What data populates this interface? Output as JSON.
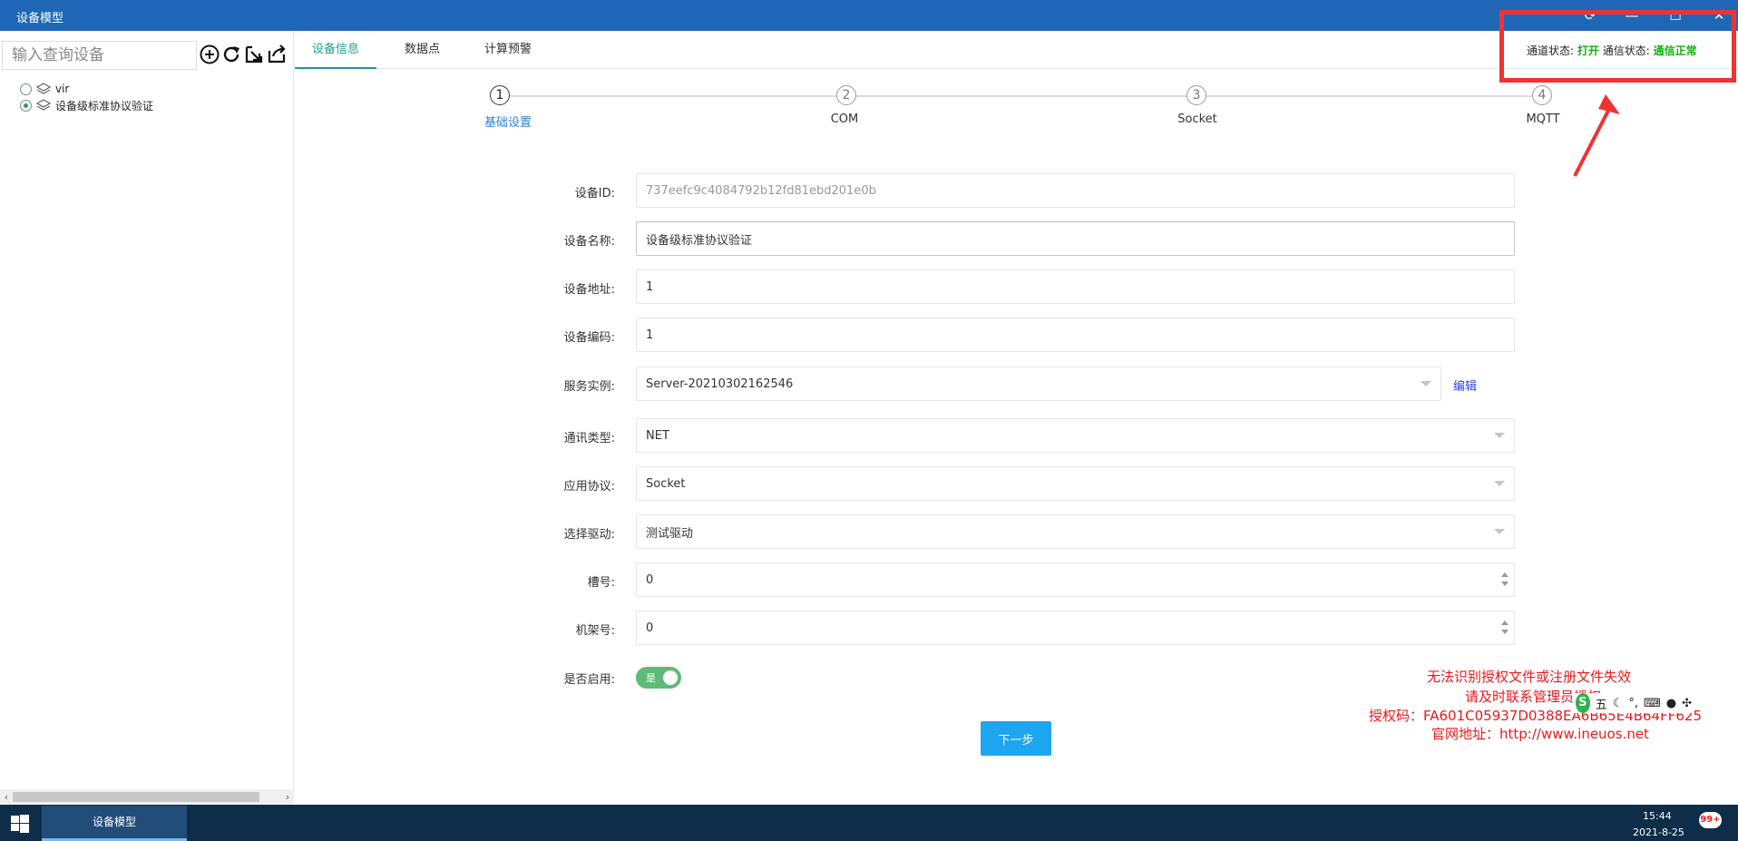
{
  "window": {
    "title": "设备模型"
  },
  "sidebar": {
    "search_placeholder": "输入查询设备",
    "tree": [
      {
        "label": "vir",
        "selected": false
      },
      {
        "label": "设备级标准协议验证",
        "selected": true
      }
    ]
  },
  "tabs": [
    {
      "label": "设备信息",
      "active": true
    },
    {
      "label": "数据点",
      "active": false
    },
    {
      "label": "计算预警",
      "active": false
    }
  ],
  "status": {
    "channel_label": "通道状态:",
    "channel_value": "打开",
    "comm_label": "通信状态:",
    "comm_value": "通信正常",
    "ok_color": "#11b011",
    "highlight_color": "#ee3333"
  },
  "steps": [
    {
      "num": "1",
      "label": "基础设置",
      "active": true
    },
    {
      "num": "2",
      "label": "COM",
      "active": false
    },
    {
      "num": "3",
      "label": "Socket",
      "active": false
    },
    {
      "num": "4",
      "label": "MQTT",
      "active": false
    }
  ],
  "form": {
    "device_id": {
      "label": "设备ID:",
      "value": "737eefc9c4084792b12fd81ebd201e0b"
    },
    "device_name": {
      "label": "设备名称:",
      "value": "设备级标准协议验证"
    },
    "device_address": {
      "label": "设备地址:",
      "value": "1"
    },
    "device_code": {
      "label": "设备编码:",
      "value": "1"
    },
    "service_instance": {
      "label": "服务实例:",
      "value": "Server-20210302162546",
      "edit_label": "编辑"
    },
    "comm_type": {
      "label": "通讯类型:",
      "value": "NET"
    },
    "app_protocol": {
      "label": "应用协议:",
      "value": "Socket"
    },
    "driver": {
      "label": "选择驱动:",
      "value": "测试驱动"
    },
    "slot": {
      "label": "槽号:",
      "value": "0"
    },
    "rack": {
      "label": "机架号:",
      "value": "0"
    },
    "enabled": {
      "label": "是否启用:",
      "value": "是",
      "on": true
    }
  },
  "next_button": "下一步",
  "license_notice": {
    "line1": "无法识别授权文件或注册文件失效",
    "line2": "请及时联系管理员授权",
    "line3": "授权码：FA601C05937D0388EA6B65E4B64FF625",
    "line4": "官网地址：http://www.ineuos.net"
  },
  "ime": {
    "mode": "五"
  },
  "taskbar": {
    "app_label": "设备模型",
    "time": "15:44",
    "date": "2021-8-25",
    "notifications": "99+"
  }
}
